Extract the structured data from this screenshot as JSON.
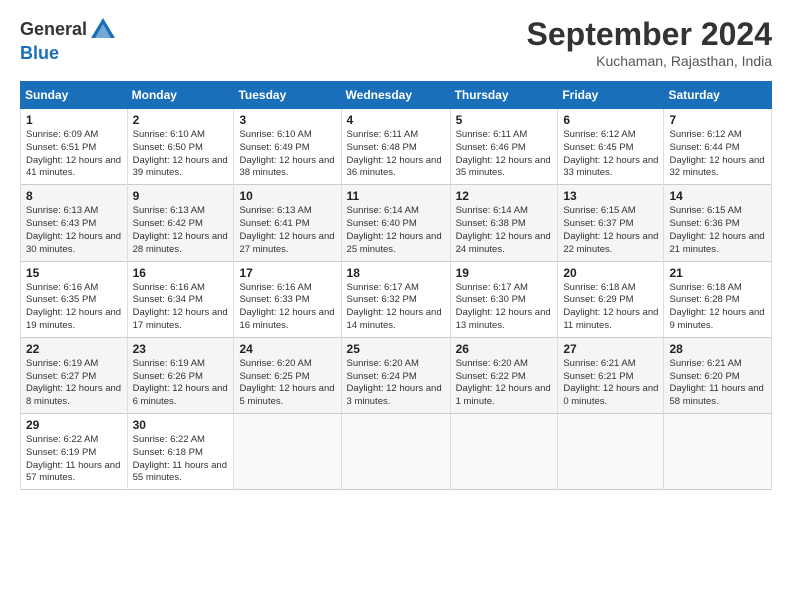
{
  "header": {
    "logo_line1": "General",
    "logo_line2": "Blue",
    "month": "September 2024",
    "location": "Kuchaman, Rajasthan, India"
  },
  "weekdays": [
    "Sunday",
    "Monday",
    "Tuesday",
    "Wednesday",
    "Thursday",
    "Friday",
    "Saturday"
  ],
  "weeks": [
    [
      {
        "day": "1",
        "sunrise": "6:09 AM",
        "sunset": "6:51 PM",
        "daylight": "12 hours and 41 minutes."
      },
      {
        "day": "2",
        "sunrise": "6:10 AM",
        "sunset": "6:50 PM",
        "daylight": "12 hours and 39 minutes."
      },
      {
        "day": "3",
        "sunrise": "6:10 AM",
        "sunset": "6:49 PM",
        "daylight": "12 hours and 38 minutes."
      },
      {
        "day": "4",
        "sunrise": "6:11 AM",
        "sunset": "6:48 PM",
        "daylight": "12 hours and 36 minutes."
      },
      {
        "day": "5",
        "sunrise": "6:11 AM",
        "sunset": "6:46 PM",
        "daylight": "12 hours and 35 minutes."
      },
      {
        "day": "6",
        "sunrise": "6:12 AM",
        "sunset": "6:45 PM",
        "daylight": "12 hours and 33 minutes."
      },
      {
        "day": "7",
        "sunrise": "6:12 AM",
        "sunset": "6:44 PM",
        "daylight": "12 hours and 32 minutes."
      }
    ],
    [
      {
        "day": "8",
        "sunrise": "6:13 AM",
        "sunset": "6:43 PM",
        "daylight": "12 hours and 30 minutes."
      },
      {
        "day": "9",
        "sunrise": "6:13 AM",
        "sunset": "6:42 PM",
        "daylight": "12 hours and 28 minutes."
      },
      {
        "day": "10",
        "sunrise": "6:13 AM",
        "sunset": "6:41 PM",
        "daylight": "12 hours and 27 minutes."
      },
      {
        "day": "11",
        "sunrise": "6:14 AM",
        "sunset": "6:40 PM",
        "daylight": "12 hours and 25 minutes."
      },
      {
        "day": "12",
        "sunrise": "6:14 AM",
        "sunset": "6:38 PM",
        "daylight": "12 hours and 24 minutes."
      },
      {
        "day": "13",
        "sunrise": "6:15 AM",
        "sunset": "6:37 PM",
        "daylight": "12 hours and 22 minutes."
      },
      {
        "day": "14",
        "sunrise": "6:15 AM",
        "sunset": "6:36 PM",
        "daylight": "12 hours and 21 minutes."
      }
    ],
    [
      {
        "day": "15",
        "sunrise": "6:16 AM",
        "sunset": "6:35 PM",
        "daylight": "12 hours and 19 minutes."
      },
      {
        "day": "16",
        "sunrise": "6:16 AM",
        "sunset": "6:34 PM",
        "daylight": "12 hours and 17 minutes."
      },
      {
        "day": "17",
        "sunrise": "6:16 AM",
        "sunset": "6:33 PM",
        "daylight": "12 hours and 16 minutes."
      },
      {
        "day": "18",
        "sunrise": "6:17 AM",
        "sunset": "6:32 PM",
        "daylight": "12 hours and 14 minutes."
      },
      {
        "day": "19",
        "sunrise": "6:17 AM",
        "sunset": "6:30 PM",
        "daylight": "12 hours and 13 minutes."
      },
      {
        "day": "20",
        "sunrise": "6:18 AM",
        "sunset": "6:29 PM",
        "daylight": "12 hours and 11 minutes."
      },
      {
        "day": "21",
        "sunrise": "6:18 AM",
        "sunset": "6:28 PM",
        "daylight": "12 hours and 9 minutes."
      }
    ],
    [
      {
        "day": "22",
        "sunrise": "6:19 AM",
        "sunset": "6:27 PM",
        "daylight": "12 hours and 8 minutes."
      },
      {
        "day": "23",
        "sunrise": "6:19 AM",
        "sunset": "6:26 PM",
        "daylight": "12 hours and 6 minutes."
      },
      {
        "day": "24",
        "sunrise": "6:20 AM",
        "sunset": "6:25 PM",
        "daylight": "12 hours and 5 minutes."
      },
      {
        "day": "25",
        "sunrise": "6:20 AM",
        "sunset": "6:24 PM",
        "daylight": "12 hours and 3 minutes."
      },
      {
        "day": "26",
        "sunrise": "6:20 AM",
        "sunset": "6:22 PM",
        "daylight": "12 hours and 1 minute."
      },
      {
        "day": "27",
        "sunrise": "6:21 AM",
        "sunset": "6:21 PM",
        "daylight": "12 hours and 0 minutes."
      },
      {
        "day": "28",
        "sunrise": "6:21 AM",
        "sunset": "6:20 PM",
        "daylight": "11 hours and 58 minutes."
      }
    ],
    [
      {
        "day": "29",
        "sunrise": "6:22 AM",
        "sunset": "6:19 PM",
        "daylight": "11 hours and 57 minutes."
      },
      {
        "day": "30",
        "sunrise": "6:22 AM",
        "sunset": "6:18 PM",
        "daylight": "11 hours and 55 minutes."
      },
      null,
      null,
      null,
      null,
      null
    ]
  ]
}
